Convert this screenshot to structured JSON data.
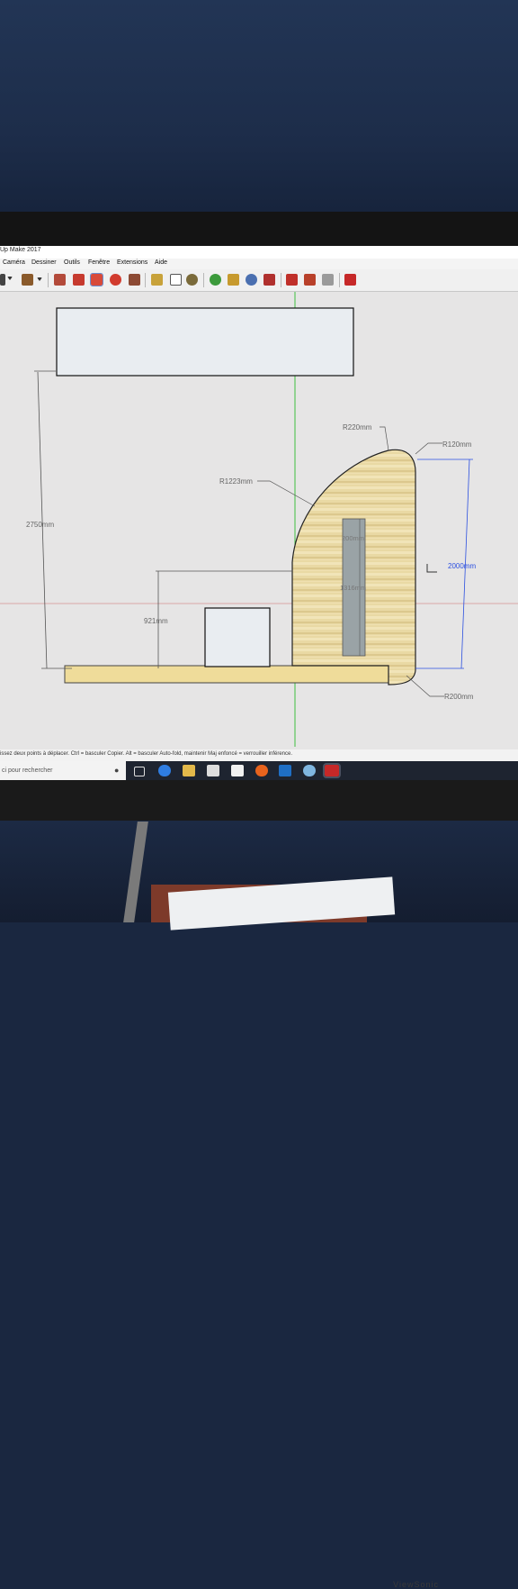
{
  "window": {
    "title": "Up Make 2017"
  },
  "menu": [
    "Caméra",
    "Dessiner",
    "Outils",
    "Fenêtre",
    "Extensions",
    "Aide"
  ],
  "toolbar_icons": [
    "select-icon",
    "dropdown-icon",
    "material-icon",
    "dropdown-icon",
    "paint-bucket-icon",
    "paint-icon",
    "move-icon",
    "rotate-icon",
    "scale-icon",
    "tape-measure-icon",
    "text-icon",
    "orbit-icon",
    "pan-icon",
    "zoom-icon",
    "zoom-extents-icon",
    "warehouse-icon",
    "extension-icon",
    "layout-icon",
    "ruby-icon"
  ],
  "drawing": {
    "dimensions": {
      "height_total": "2750mm",
      "height_right": "2000mm",
      "height_left": "921mm",
      "bar_length": "1316mm",
      "bar_width": "200mm",
      "radius_arc": "R1223mm",
      "radius_top": "R220mm",
      "radius_corner_top": "R120mm",
      "radius_corner_bottom": "R200mm"
    }
  },
  "status_text": "issez deux points à déplacer.  Ctrl = basculer Copier.  Alt = basculer Auto-fold, maintenir Maj enfoncé = verrouiller inférence.",
  "taskbar": {
    "search_placeholder": "ci pour rechercher",
    "apps": [
      "task-view-icon",
      "edge-icon",
      "file-explorer-icon",
      "store-icon",
      "mail-icon",
      "firefox-icon",
      "outlook-icon",
      "app-icon",
      "sketchup-icon"
    ]
  },
  "monitor_brand": "ViewSonic",
  "colors": {
    "wood": "#e9d9a4",
    "base": "#efdc9a",
    "axis_green": "#3fbf3f",
    "dimension_blue": "#2b4fe0"
  }
}
